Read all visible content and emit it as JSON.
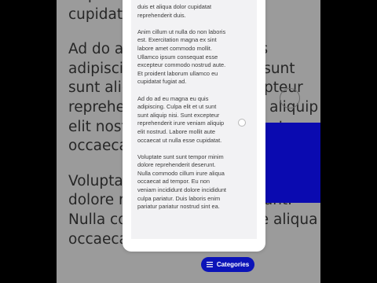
{
  "background": {
    "paragraphs": [
      "Et proident laborum ullamco eu\ncupidatat fugiat ad.",
      "Ad do ad eu magna eu quis\nadipiscing. Culpa elit et ut sunt\nsunt aliquip nisi. Sunt excepteur\nreprehenderit irure veniam aliquip\nelit nostrud. Labore mollit aute\noccaecat ut nulla esse cupidatat.",
      "Voluptate sunt sunt tempor minim\ndolore reprehenderit deserunt.\nNulla commodo cillum irure aliqua\noccaecat ad tempor."
    ]
  },
  "document": {
    "paragraphs": [
      "duis et aliqua dolor cupidatat\nreprehenderit duis.",
      "Anim cillum ut nulla do non laboris\nest. Exercitation magna ex sint\nlabore amet commodo mollit.\nUllamco ipsum consequat esse\nexcepteur commodo nostrud aute.\nEt proident laborum ullamco eu\ncupidatat fugiat ad.",
      "Ad do ad eu magna eu quis\nadipiscing. Culpa elit et ut sunt\nsunt aliquip nisi. Sunt excepteur\nreprehenderit irure veniam aliquip\nelit nostrud. Labore mollit aute\noccaecat ut nulla esse cupidatat.",
      "Voluptate sunt sunt tempor minim\ndolore reprehenderit deserunt.\nNulla commodo cillum irure aliqua\noccaecat ad tempor. Eu non\nveniam incididunt dolore incididunt\nculpa pariatur. Duis laboris enim\npariatur pariatur nostrud sint ea."
    ]
  },
  "categories_button": {
    "label": "Categories",
    "icon": "menu-icon"
  },
  "colors": {
    "accent": "#0b13b8",
    "overlay": "#9b9b9b",
    "card": "#ffffff",
    "card_inner": "#f2f2f4"
  }
}
